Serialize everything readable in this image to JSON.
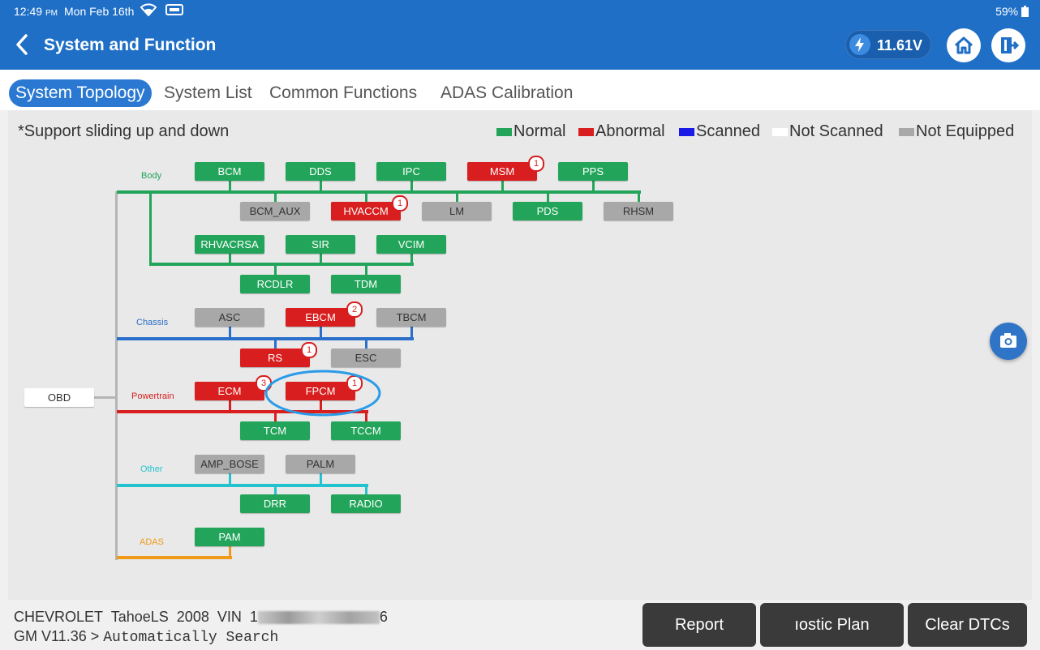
{
  "status_bar": {
    "time": "12:49",
    "ampm": "PM",
    "date": "Mon Feb 16th",
    "battery": "59%",
    "wifi_icon": "wifi-icon",
    "vci_icon": "vci-connector-icon"
  },
  "header": {
    "title": "System and Function",
    "voltage": "11.61V"
  },
  "tabs": [
    "System Topology",
    "System List",
    "Common Functions",
    "ADAS Calibration"
  ],
  "active_tab": 0,
  "note": "*Support sliding up and down",
  "legend": [
    {
      "label": "Normal",
      "color": "#22a55a"
    },
    {
      "label": "Abnormal",
      "color": "#d81e1e"
    },
    {
      "label": "Scanned",
      "color": "#1a1ae6"
    },
    {
      "label": "Not Scanned",
      "color": "#ffffff"
    },
    {
      "label": "Not Equipped",
      "color": "#a8a8a8"
    }
  ],
  "groups": {
    "body": "Body",
    "chassis": "Chassis",
    "powertrain": "Powertrain",
    "other": "Other",
    "adas": "ADAS"
  },
  "colors": {
    "body": "#22a55a",
    "chassis": "#2a6fc9",
    "powertrain": "#d81e1e",
    "other": "#22c3cf",
    "adas": "#f09a1a",
    "trunk": "#b5b5b5",
    "highlight": "#2a9be8"
  },
  "modules": {
    "obd": "OBD",
    "bcm": "BCM",
    "dds": "DDS",
    "ipc": "IPC",
    "msm": "MSM",
    "pps": "PPS",
    "bcm_aux": "BCM_AUX",
    "hvaccm": "HVACCM",
    "lm": "LM",
    "pds": "PDS",
    "rhsm": "RHSM",
    "rhvacrsa": "RHVACRSA",
    "sir": "SIR",
    "vcim": "VCIM",
    "rcdlr": "RCDLR",
    "tdm": "TDM",
    "asc": "ASC",
    "ebcm": "EBCM",
    "tbcm": "TBCM",
    "rs": "RS",
    "esc": "ESC",
    "ecm": "ECM",
    "fpcm": "FPCM",
    "tcm": "TCM",
    "tccm": "TCCM",
    "amp_bose": "AMP_BOSE",
    "palm": "PALM",
    "drr": "DRR",
    "radio": "RADIO",
    "pam": "PAM"
  },
  "badges": {
    "msm": "1",
    "hvaccm": "1",
    "ebcm": "2",
    "rs": "1",
    "ecm": "3",
    "fpcm": "1"
  },
  "footer": {
    "make": "CHEVROLET",
    "model": "TahoeLS",
    "year": "2008",
    "vin_label": "VIN",
    "vin_start": "1",
    "vin_end": "6",
    "version": "GM V11.36 >",
    "path": "Automatically Search",
    "buttons": {
      "report": "Report",
      "plan": "ıostic Plan",
      "clear": "Clear DTCs"
    }
  }
}
